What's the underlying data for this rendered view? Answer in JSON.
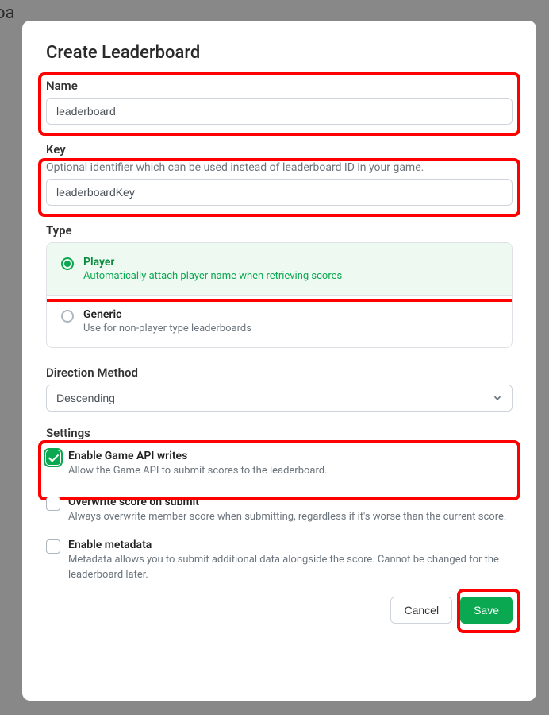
{
  "background": {
    "partialText": "oa"
  },
  "modal": {
    "title": "Create Leaderboard",
    "name": {
      "label": "Name",
      "value": "leaderboard"
    },
    "key": {
      "label": "Key",
      "helper": "Optional identifier which can be used instead of leaderboard ID in your game.",
      "value": "leaderboardKey"
    },
    "type": {
      "label": "Type",
      "options": [
        {
          "title": "Player",
          "desc": "Automatically attach player name when retrieving scores",
          "selected": true
        },
        {
          "title": "Generic",
          "desc": "Use for non-player type leaderboards",
          "selected": false
        }
      ]
    },
    "direction": {
      "label": "Direction Method",
      "value": "Descending"
    },
    "settings": {
      "label": "Settings",
      "items": [
        {
          "title": "Enable Game API writes",
          "desc": "Allow the Game API to submit scores to the leaderboard.",
          "checked": true
        },
        {
          "title": "Overwrite score on submit",
          "desc": "Always overwrite member score when submitting, regardless if it's worse than the current score.",
          "checked": false
        },
        {
          "title": "Enable metadata",
          "desc": "Metadata allows you to submit additional data alongside the score. Cannot be changed for the leaderboard later.",
          "checked": false
        }
      ]
    },
    "footer": {
      "cancel": "Cancel",
      "save": "Save"
    }
  }
}
